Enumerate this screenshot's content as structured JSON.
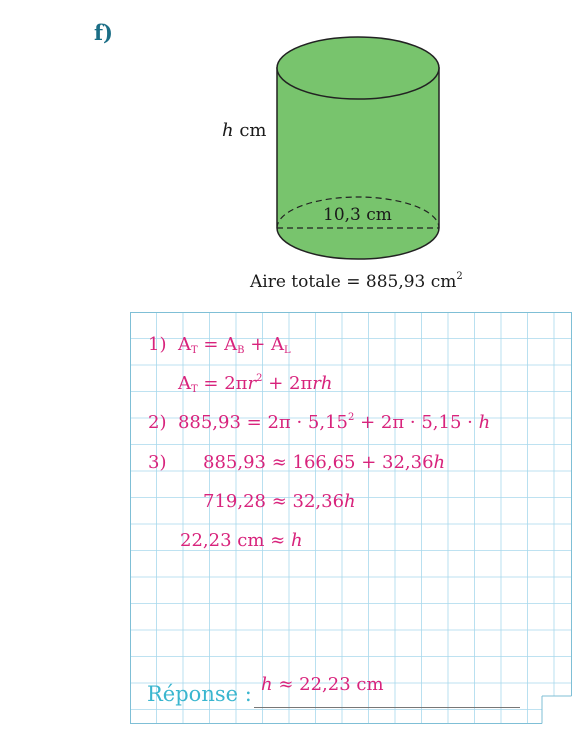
{
  "exercise_letter": "f)",
  "figure": {
    "height_var": "h",
    "height_unit": "cm",
    "diameter": "10,3 cm",
    "area_prefix": "Aire totale = 885,93 cm",
    "area_exp": "2",
    "cylinder_color": "#78c46d"
  },
  "work": {
    "l1_num": "1)",
    "l1_a": "A",
    "l1_a_sub": "T",
    "l1_eq": " = A",
    "l1_b_sub": "B",
    "l1_plus": " + A",
    "l1_c_sub": "L",
    "l2_a": "A",
    "l2_a_sub": "T",
    "l2_eq": " = 2π",
    "l2_r": "r",
    "l2_exp": "2",
    "l2_plus": " + 2π",
    "l2_rh": "rh",
    "l3_num": "2)",
    "l3_text": "885,93 = 2π · 5,15",
    "l3_exp": "2",
    "l3_rest": " + 2π · 5,15 · ",
    "l3_h": "h",
    "l4_num": "3)",
    "l4_text": "885,93 ≈ 166,65 + 32,36",
    "l4_h": "h",
    "l5_text": "719,28 ≈ 32,36",
    "l5_h": "h",
    "l6_text": "22,23 cm ≈ ",
    "l6_h": "h"
  },
  "answer": {
    "label": "Réponse :",
    "value_var": "h",
    "value_rest": " ≈ 22,23 cm"
  },
  "colors": {
    "pink": "#d8237c",
    "teal": "#1b6e86",
    "cyan": "#3ab6cf",
    "grid": "#a8d8ec"
  }
}
